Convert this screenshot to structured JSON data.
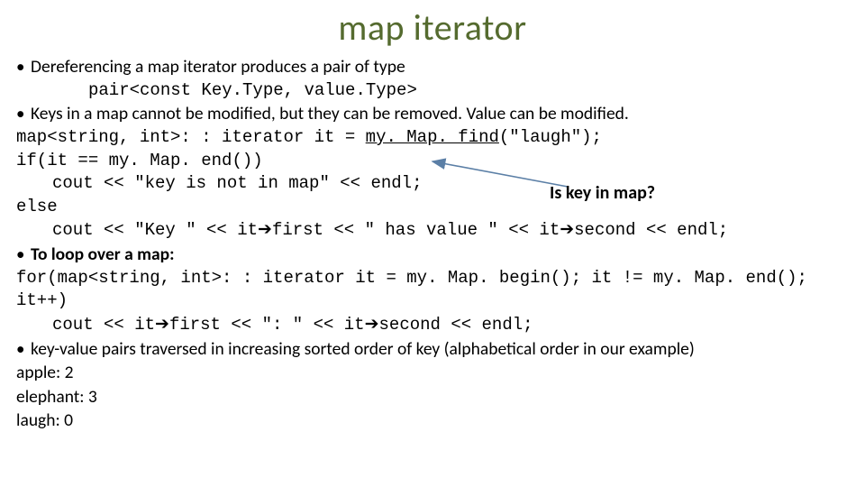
{
  "title": "map iterator",
  "bullets": {
    "b1": "Dereferencing a map iterator produces a pair of type",
    "b1code": "pair<const Key.Type, value.Type>",
    "b2": "Keys in a map cannot be modified, but they can be removed. Value can be modified.",
    "b3": "To loop over a map:",
    "b4": "key-value pairs traversed in increasing sorted order of key (alphabetical order in our example)"
  },
  "code": {
    "c1a": "map<string, int>: : iterator it = ",
    "c1b": "my. Map. find",
    "c1c": "(\"laugh\");",
    "c2": "if(it == my. Map. end())",
    "c3": "cout << \"key is not in map\" << endl;",
    "c4": "else",
    "c5a": "cout << \"Key \" << it",
    "c5b": "first << \" has value \" << it",
    "c5c": "second << endl;",
    "c6": "for(map<string, int>: : iterator it = my. Map. begin(); it != my. Map. end(); it++)",
    "c7a": "cout << it",
    "c7b": "first << \": \" << it",
    "c7c": "second << endl;"
  },
  "output": {
    "o1": "apple: 2",
    "o2": "elephant: 3",
    "o3": "laugh: 0"
  },
  "annotation": "Is key in map?",
  "glyphs": {
    "bullet": "•",
    "arrow": "➔"
  }
}
